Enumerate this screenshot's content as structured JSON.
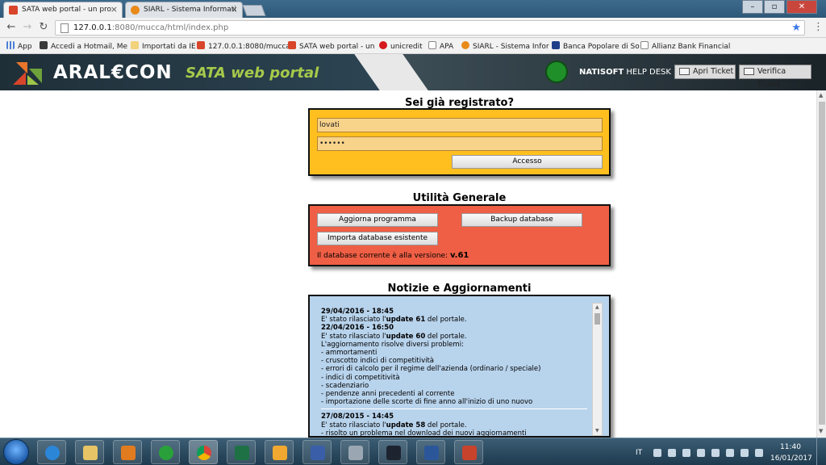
{
  "browser": {
    "tabs": [
      {
        "title": "SATA web portal - un pro",
        "active": true
      },
      {
        "title": "SIARL - Sistema Informati",
        "active": false
      }
    ],
    "address": {
      "host": "127.0.0.1",
      "rest": ":8080/mucca/html/index.php"
    },
    "bookmarks": [
      {
        "label": "App",
        "icon": "apps-grid-icon"
      },
      {
        "label": "Accedi a Hotmail, Me",
        "icon": "msn-icon"
      },
      {
        "label": "Importati da IE",
        "icon": "folder-icon"
      },
      {
        "label": "127.0.0.1:8080/mucca",
        "icon": "sata-icon"
      },
      {
        "label": "SATA web portal - un",
        "icon": "sata-icon"
      },
      {
        "label": "unicredit",
        "icon": "unicredit-icon"
      },
      {
        "label": "APA",
        "icon": "page-icon"
      },
      {
        "label": "SIARL - Sistema Infor",
        "icon": "siarl-icon"
      },
      {
        "label": "Banca Popolare di So",
        "icon": "bank-icon"
      },
      {
        "label": "Allianz Bank Financial",
        "icon": "page-icon"
      }
    ]
  },
  "header": {
    "brand": "ARAL€CON",
    "portal": "SATA web portal",
    "helpdesk_prefix": "NATISOFT",
    "helpdesk_suffix": " HELP DESK",
    "apri_label": "Apri Ticket",
    "verifica_label": "Verifica Ticket"
  },
  "login": {
    "title": "Sei già registrato?",
    "username": "lovati",
    "password_mask": "••••••",
    "access_label": "Accesso"
  },
  "utility": {
    "title": "Utilità Generale",
    "update_label": "Aggiorna programma",
    "backup_label": "Backup database",
    "import_label": "Importa database esistente",
    "version_text": "Il database corrente è alla versione: ",
    "version_value": "v.61"
  },
  "news": {
    "title": "Notizie e Aggiornamenti",
    "entries": [
      {
        "date": "29/04/2016 - 18:45",
        "pre": "E' stato rilasciato l'",
        "update": "update 61",
        "post": " del portale."
      },
      {
        "date": "22/04/2016 - 16:50",
        "pre": "E' stato rilasciato l'",
        "update": "update 60",
        "post": " del portale."
      }
    ],
    "problems_intro": "L'aggiornamento risolve diversi problemi:",
    "problems": [
      "- ammortamenti",
      "- cruscotto indici di competitività",
      "- errori di calcolo per il regime dell'azienda (ordinario / speciale)",
      "- indici di competitività",
      "- scadenziario",
      "- pendenze anni precedenti al corrente",
      "- importazione delle scorte di fine anno all'inizio di uno nuovo"
    ],
    "entry3": {
      "date": "27/08/2015 - 14:45",
      "pre": "E' stato rilasciato l'",
      "update": "update 58",
      "post": " del portale."
    },
    "entry3_line": "- risolto un problema nel download dei nuovi aggiornamenti"
  },
  "taskbar": {
    "lang": "IT",
    "time": "11:40",
    "date": "16/01/2017",
    "apps": [
      "ie-icon",
      "explorer-icon",
      "media-player-icon",
      "green-app-icon",
      "chrome-icon",
      "excel-icon",
      "outlook-icon",
      "virtualbox-icon",
      "calculator-icon",
      "natisoft-icon",
      "word-icon",
      "powerpoint-icon"
    ]
  }
}
